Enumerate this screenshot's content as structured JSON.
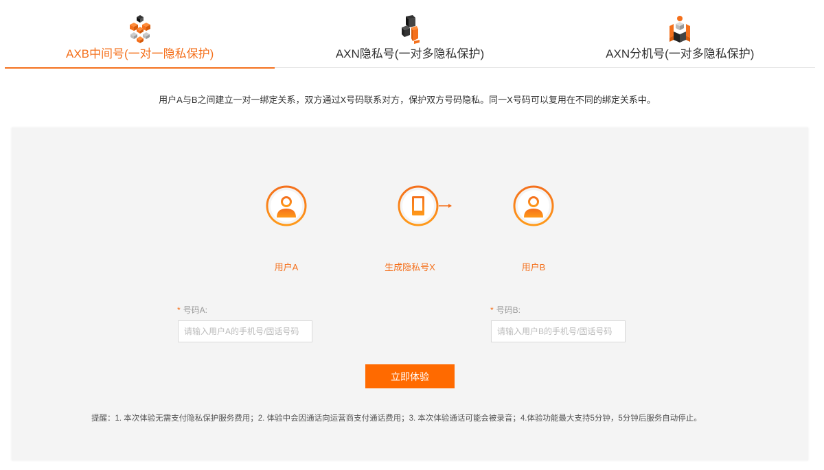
{
  "tabs": [
    {
      "label": "AXB中间号(一对一隐私保护)",
      "icon": "cubes-icon",
      "active": true
    },
    {
      "label": "AXN隐私号(一对多隐私保护)",
      "icon": "blocks-icon",
      "active": false
    },
    {
      "label": "AXN分机号(一对多隐私保护)",
      "icon": "box-cluster-icon",
      "active": false
    }
  ],
  "intro": "用户A与B之间建立一对一绑定关系，双方通过X号码联系对方，保护双方号码隐私。同一X号码可以复用在不同的绑定关系中。",
  "flow": {
    "user_a": "用户A",
    "generate": "生成隐私号X",
    "user_b": "用户B"
  },
  "form": {
    "required_mark": "*",
    "number_a_label": "号码A:",
    "number_a_placeholder": "请输入用户A的手机号/固话号码",
    "number_b_label": "号码B:",
    "number_b_placeholder": "请输入用户B的手机号/固话号码",
    "submit_label": "立即体验"
  },
  "notice": "提醒：1. 本次体验无需支付隐私保护服务费用；2. 体验中会因通话向运营商支付通话费用；3. 本次体验通话可能会被录音；4.体验功能最大支持5分钟，5分钟后服务自动停止。",
  "colors": {
    "accent": "#f4701c",
    "button": "#ff6a00",
    "panel": "#f4f4f4"
  }
}
